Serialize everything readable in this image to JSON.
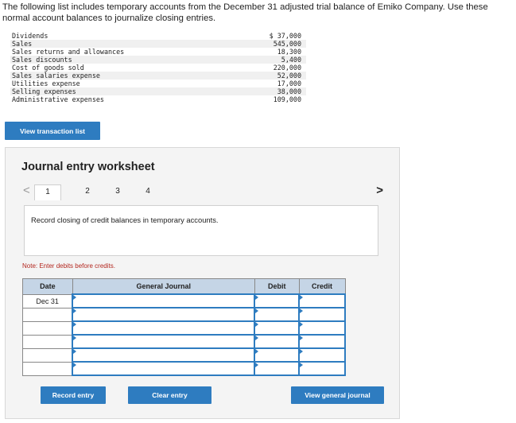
{
  "intro": "The following list includes temporary accounts from the December 31 adjusted trial balance of Emiko Company. Use these normal account balances to journalize closing entries.",
  "trial_balance": [
    {
      "name": "Dividends",
      "amount": "$ 37,000"
    },
    {
      "name": "Sales",
      "amount": "545,000"
    },
    {
      "name": "Sales returns and allowances",
      "amount": "18,300"
    },
    {
      "name": "Sales discounts",
      "amount": "5,400"
    },
    {
      "name": "Cost of goods sold",
      "amount": "220,000"
    },
    {
      "name": "Sales salaries expense",
      "amount": "52,000"
    },
    {
      "name": "Utilities expense",
      "amount": "17,000"
    },
    {
      "name": "Selling expenses",
      "amount": "38,000"
    },
    {
      "name": "Administrative expenses",
      "amount": "109,000"
    }
  ],
  "buttons": {
    "view_transaction_list": "View transaction list",
    "record_entry": "Record entry",
    "clear_entry": "Clear entry",
    "view_general_journal": "View general journal"
  },
  "worksheet": {
    "title": "Journal entry worksheet",
    "pages": [
      "1",
      "2",
      "3",
      "4"
    ],
    "active_page": "1",
    "prompt": "Record closing of credit balances in temporary accounts.",
    "note": "Note: Enter debits before credits.",
    "columns": {
      "date": "Date",
      "general_journal": "General Journal",
      "debit": "Debit",
      "credit": "Credit"
    },
    "rows": [
      {
        "date": "Dec 31",
        "account": "",
        "debit": "",
        "credit": ""
      },
      {
        "date": "",
        "account": "",
        "debit": "",
        "credit": ""
      },
      {
        "date": "",
        "account": "",
        "debit": "",
        "credit": ""
      },
      {
        "date": "",
        "account": "",
        "debit": "",
        "credit": ""
      },
      {
        "date": "",
        "account": "",
        "debit": "",
        "credit": ""
      },
      {
        "date": "",
        "account": "",
        "debit": "",
        "credit": ""
      }
    ]
  },
  "icons": {
    "prev": "chevron-left-icon",
    "next": "chevron-right-icon"
  },
  "colors": {
    "accent": "#2e7cc0",
    "header_fill": "#c5d5e6",
    "note": "#b3261e"
  }
}
